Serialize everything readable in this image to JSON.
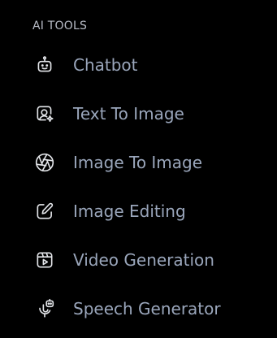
{
  "section": {
    "title": "AI TOOLS"
  },
  "items": [
    {
      "label": "Chatbot",
      "icon": "bot-icon"
    },
    {
      "label": "Text To Image",
      "icon": "image-sparkle-icon"
    },
    {
      "label": "Image To Image",
      "icon": "aperture-icon"
    },
    {
      "label": "Image Editing",
      "icon": "edit-square-icon"
    },
    {
      "label": "Video Generation",
      "icon": "video-play-icon"
    },
    {
      "label": "Speech Generator",
      "icon": "microphone-bot-icon"
    }
  ],
  "colors": {
    "background": "#000000",
    "heading": "#b8bcc6",
    "label": "#9aa6bb",
    "icon": "#e4e6ea"
  }
}
